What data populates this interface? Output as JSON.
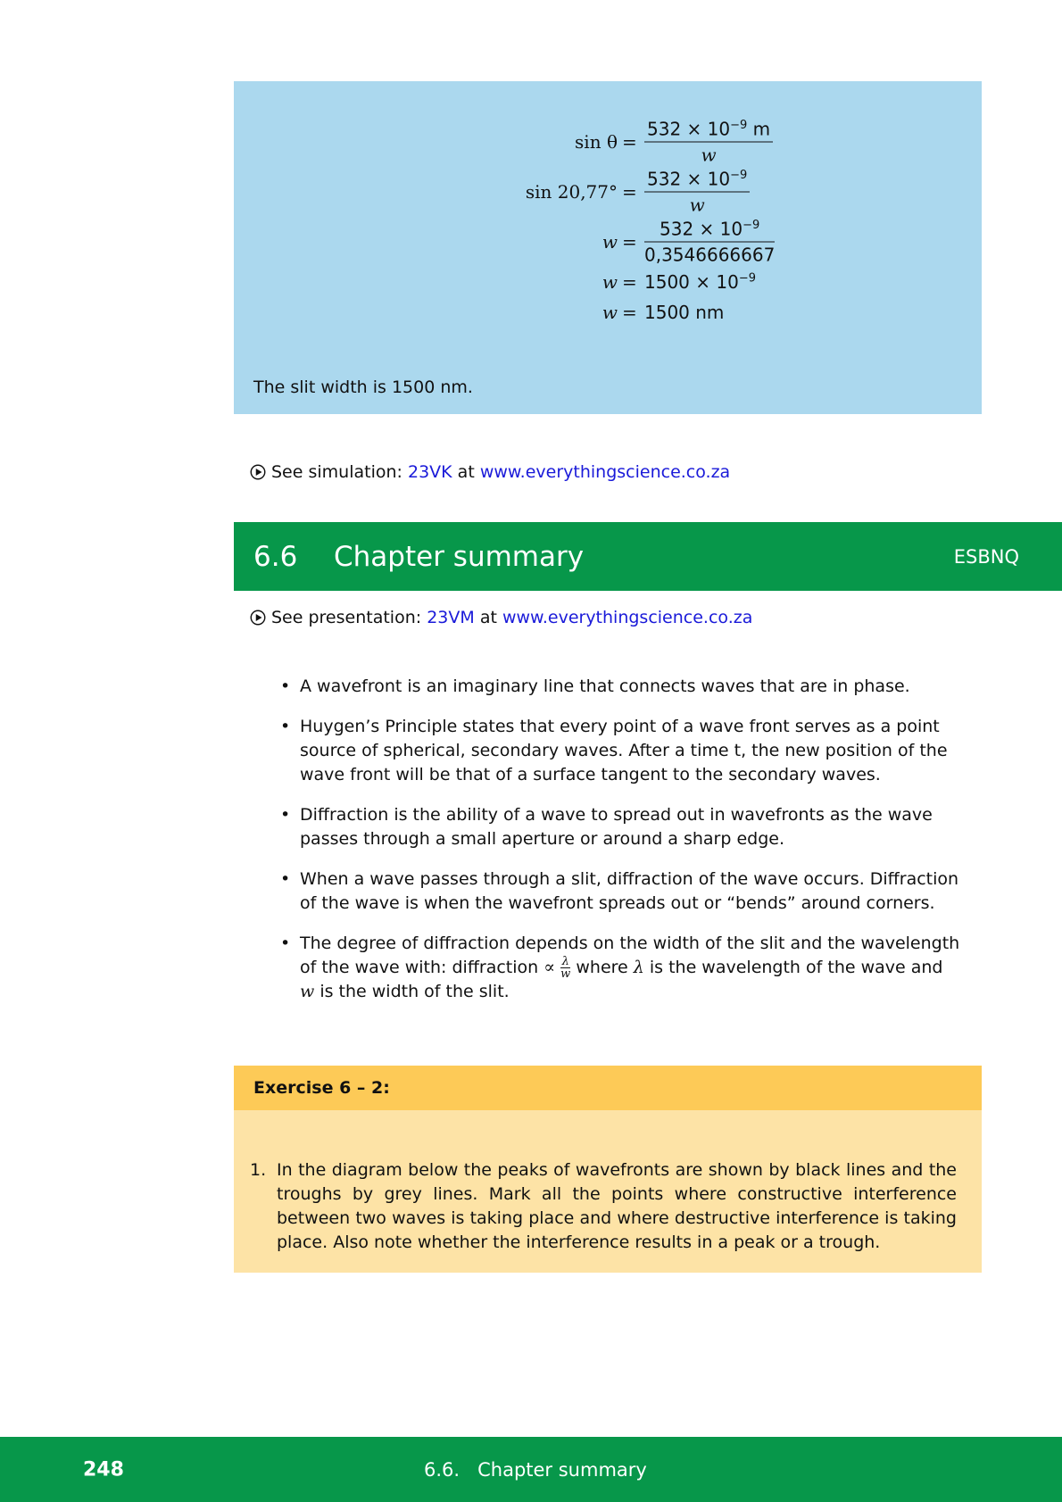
{
  "example": {
    "equations": [
      {
        "lhs": "sin θ",
        "numerator": "532 × 10",
        "exp": "−9",
        "unit": " m",
        "denominator": "w"
      },
      {
        "lhs": "sin 20,77°",
        "numerator": "532 × 10",
        "exp": "−9",
        "unit": "",
        "denominator": "w"
      },
      {
        "lhs": "w",
        "numerator": "532 × 10",
        "exp": "−9",
        "unit": "",
        "denominator": "0,3546666667"
      },
      {
        "lhs": "w",
        "rhs_base": "1500 × 10",
        "exp": "−9"
      },
      {
        "lhs": "w",
        "rhs_text": "1500 nm"
      }
    ],
    "conclusion": "The slit width is 1500 nm."
  },
  "simulation_link": {
    "prefix": "See simulation:",
    "code": "23VK",
    "at": "at",
    "url": "www.everythingscience.co.za"
  },
  "section": {
    "number": "6.6",
    "title": "Chapter summary",
    "code": "ESBNQ"
  },
  "presentation_link": {
    "prefix": "See presentation:",
    "code": "23VM",
    "at": "at",
    "url": "www.everythingscience.co.za"
  },
  "summary": {
    "items": [
      "A wavefront is an imaginary line that connects waves that are in phase.",
      "Huygen’s Principle states that every point of a wave front serves as a point source of spherical, secondary waves. After a time t, the new position of the wave front will be that of a surface tangent to the secondary waves.",
      "Diffraction is the ability of a wave to spread out in wavefronts as the wave passes through a small aperture or around a sharp edge.",
      "When a wave passes through a slit, diffraction of the wave occurs. Diffraction of the wave is when the wavefront spreads out or “bends” around corners."
    ],
    "last_item": {
      "part1": "The degree of diffraction depends on the width of the slit and the wavelength of the wave with: diffraction",
      "propto": "∝",
      "frac_num": "λ",
      "frac_den": "w",
      "part2": "where",
      "lambda": "λ",
      "part3": "is the wavelength of the wave and",
      "w": "w",
      "part4": "is the width of the slit."
    }
  },
  "exercise": {
    "title": "Exercise 6 – 2:",
    "item_number": "1.",
    "item_text": "In the diagram below the peaks of wavefronts are shown by black lines and the troughs by grey lines. Mark all the points where constructive interference between two waves is taking place and where destructive interference is taking place. Also note whether the interference results in a peak or a trough."
  },
  "footer": {
    "page_number": "248",
    "section_label": "6.6.   Chapter summary"
  }
}
